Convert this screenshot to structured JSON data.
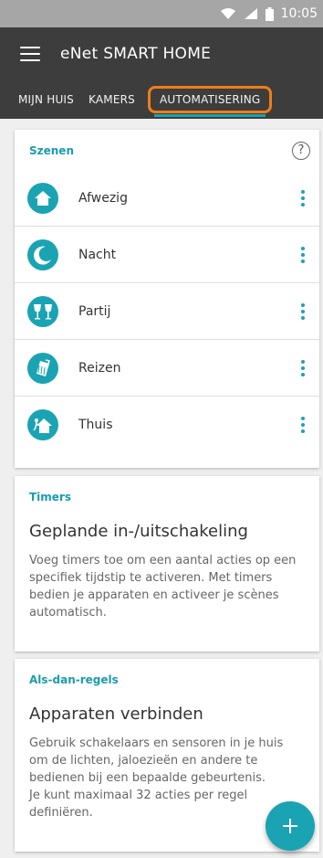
{
  "status_bar": {
    "time": "10:05"
  },
  "app_bar": {
    "title": "eNet SMART HOME"
  },
  "tabs": [
    {
      "label": "MIJN HUIS"
    },
    {
      "label": "KAMERS"
    },
    {
      "label": "AUTOMATISERING",
      "active": true
    }
  ],
  "scenes": {
    "heading": "Szenen",
    "help_icon": "?",
    "items": [
      {
        "label": "Afwezig",
        "icon": "house-icon"
      },
      {
        "label": "Nacht",
        "icon": "moon-icon"
      },
      {
        "label": "Partij",
        "icon": "glasses-icon"
      },
      {
        "label": "Reizen",
        "icon": "luggage-icon"
      },
      {
        "label": "Thuis",
        "icon": "house-enter-icon"
      }
    ]
  },
  "timers": {
    "heading": "Timers",
    "title": "Geplande in-/uitschakeling",
    "body": "Voeg timers toe om een aantal acties op een specifiek tijdstip te activeren. Met timers bedien je apparaten en activeer je scènes automatisch."
  },
  "rules": {
    "heading": "Als-dan-regels",
    "title": "Apparaten verbinden",
    "body_lines": [
      "Gebruik schakelaars en sensoren in je huis om de lichten, jaloezieën en andere te bedienen bij een bepaalde gebeurtenis.",
      "Je kunt maximaal 32 acties per regel definiëren."
    ]
  },
  "fab": {
    "symbol": "+"
  },
  "colors": {
    "accent": "#1aa3b3",
    "highlight": "#f07d1a",
    "appbar": "#3d3d3d"
  }
}
